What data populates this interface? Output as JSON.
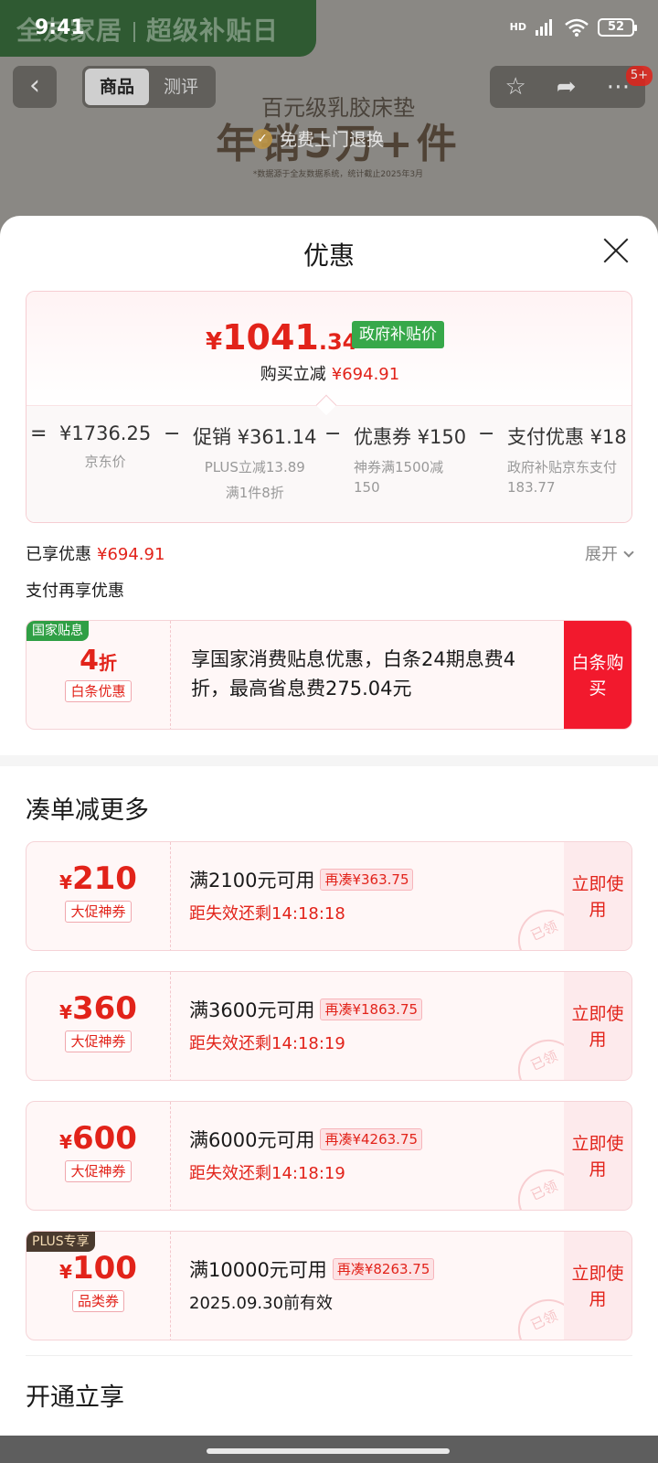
{
  "status_bar": {
    "time": "9:41",
    "network": "HD",
    "battery": "52"
  },
  "background": {
    "banner_brand": "全友家居",
    "banner_event": "超级补贴日",
    "tabs": [
      "商品",
      "测评"
    ],
    "badge": "5+",
    "product_line1": "百元级乳胶床垫",
    "product_line2": "年销5万+件",
    "product_note": "*数据源于全友数据系统，统计截止2025年3月",
    "return_text": "免费上门退换"
  },
  "sheet": {
    "title": "优惠",
    "final_price": {
      "currency": "¥",
      "integer": "1041",
      "decimal": ".34"
    },
    "gov_price_tag": "政府补贴价",
    "instant_save_label": "购买立减",
    "instant_save_amount": "¥694.91",
    "breakdown": [
      {
        "op": "=",
        "value": "¥1736.25",
        "sub1": "京东价",
        "sub2": ""
      },
      {
        "op": "−",
        "value": "促销 ¥361.14",
        "sub1": "PLUS立减13.89",
        "sub2": "满1件8折"
      },
      {
        "op": "−",
        "value": "优惠券 ¥150",
        "sub1": "神券满1500减",
        "sub2": "150"
      },
      {
        "op": "−",
        "value": "支付优惠 ¥18",
        "sub1": "政府补贴京东支付",
        "sub2": "183.77"
      }
    ],
    "enjoyed_label": "已享优惠",
    "enjoyed_amount": "¥694.91",
    "expand_label": "展开",
    "pay_more_label": "支付再享优惠",
    "gov_coupon": {
      "label": "国家贴息",
      "discount": "4",
      "discount_unit": "折",
      "tag": "白条优惠",
      "desc": "享国家消费贴息优惠，白条24期息费4折，最高省息费275.04元",
      "action": "白条购买"
    },
    "section_more": "凑单减更多",
    "coupons": [
      {
        "currency": "¥",
        "amount": "210",
        "tag": "大促神券",
        "condition": "满2100元可用",
        "need": "再凑¥363.75",
        "expire": "距失效还剩14:18:18",
        "action": "立即使用",
        "stamp": "已领",
        "plus": ""
      },
      {
        "currency": "¥",
        "amount": "360",
        "tag": "大促神券",
        "condition": "满3600元可用",
        "need": "再凑¥1863.75",
        "expire": "距失效还剩14:18:19",
        "action": "立即使用",
        "stamp": "已领",
        "plus": ""
      },
      {
        "currency": "¥",
        "amount": "600",
        "tag": "大促神券",
        "condition": "满6000元可用",
        "need": "再凑¥4263.75",
        "expire": "距失效还剩14:18:19",
        "action": "立即使用",
        "stamp": "已领",
        "plus": ""
      },
      {
        "currency": "¥",
        "amount": "100",
        "tag": "品类券",
        "condition": "满10000元可用",
        "need": "再凑¥8263.75",
        "expire": "2025.09.30前有效",
        "action": "立即使用",
        "stamp": "已领",
        "plus": "PLUS专享"
      }
    ],
    "section_open": "开通立享"
  },
  "colors": {
    "accent_red": "#e2231a",
    "gov_green": "#37a84a",
    "action_red": "#f2192d"
  }
}
